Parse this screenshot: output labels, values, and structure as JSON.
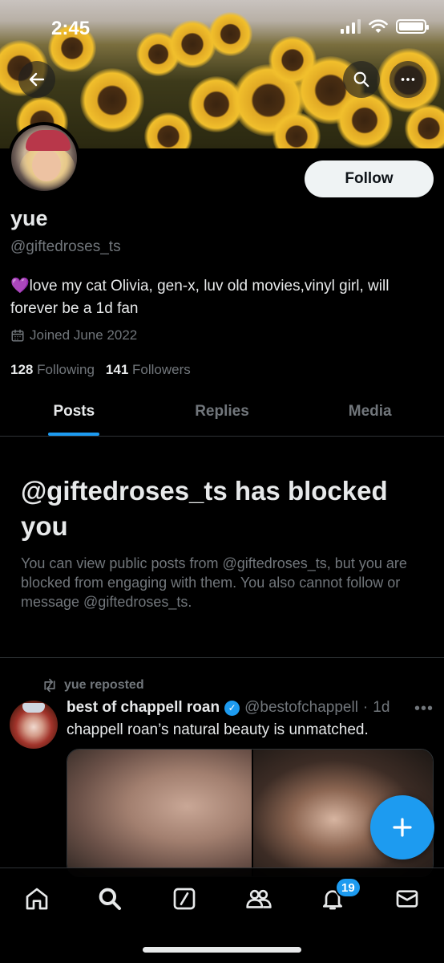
{
  "status_bar": {
    "time": "2:45"
  },
  "profile": {
    "display_name": "yue",
    "handle": "@giftedroses_ts",
    "bio_emoji": "💜",
    "bio_text": "love my cat Olivia, gen-x, luv old movies,vinyl girl, will forever be a 1d fan",
    "joined": "Joined June 2022",
    "following_count": "128",
    "following_label": "Following",
    "followers_count": "141",
    "followers_label": "Followers",
    "follow_button": "Follow"
  },
  "tabs": [
    {
      "label": "Posts",
      "active": true
    },
    {
      "label": "Replies",
      "active": false
    },
    {
      "label": "Media",
      "active": false
    }
  ],
  "blocked": {
    "title": "@giftedroses_ts has blocked you",
    "message": "You can view public posts from @giftedroses_ts, but you are blocked from engaging with them. You also cannot follow or message @giftedroses_ts."
  },
  "post": {
    "repost_label": "yue reposted",
    "author_name": "best of chappell roan",
    "author_handle": "@bestofchappell",
    "time": "1d",
    "separator": "·",
    "text": "chappell roan’s natural beauty is unmatched."
  },
  "nav": {
    "notifications_badge": "19"
  },
  "icons": {
    "back": "back-arrow-icon",
    "search": "search-icon",
    "more": "more-icon",
    "calendar": "calendar-icon",
    "repost": "repost-icon",
    "verified": "verified-badge-icon",
    "compose": "plus-icon",
    "home": "home-icon",
    "explore": "search-icon",
    "grok": "grok-icon",
    "communities": "communities-icon",
    "notifications": "bell-icon",
    "messages": "mail-icon"
  },
  "colors": {
    "accent": "#1d9bf0",
    "background": "#000000",
    "secondary_text": "#71767b",
    "primary_text": "#e7e9ea"
  }
}
